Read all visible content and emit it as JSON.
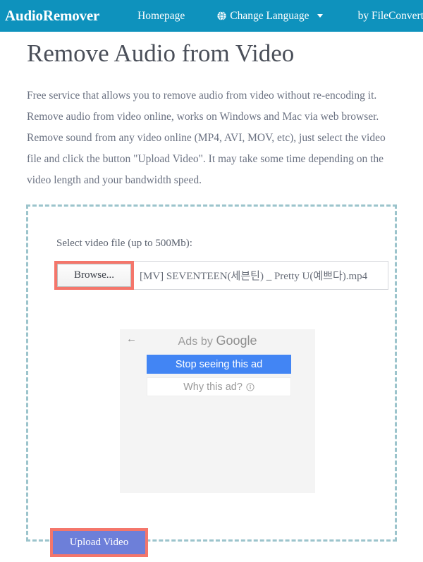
{
  "navbar": {
    "brand": "AudioRemover",
    "links": [
      {
        "label": "Homepage",
        "name": "nav-link-homepage"
      },
      {
        "label": "Change Language",
        "name": "nav-link-change-language",
        "icon": "globe-icon",
        "caret": "chevron-down-icon"
      },
      {
        "label": "by FileConverto",
        "name": "nav-link-by-fileconverto"
      }
    ],
    "background_color": "#0e92bd",
    "text_color": "#ffffff"
  },
  "main": {
    "title": "Remove Audio from Video",
    "intro": "Free service that allows you to remove audio from video without re-encoding it. Remove audio from video online, works on Windows and Mac via web browser. Remove sound from any video online (MP4, AVI, MOV, etc), just select the video file and click the button \"Upload Video\". It may take some time depending on the video length and your bandwidth speed."
  },
  "upload": {
    "select_label": "Select video file (up to 500Mb):",
    "browse_label": "Browse...",
    "file_name": "[MV] SEVENTEEN(세븐틴) _ Pretty U(예쁘다).mp4",
    "submit_label": "Upload Video",
    "dashed_border_color": "#9cc4cc",
    "highlight_color": "#f4766b",
    "submit_color": "#6d7fd9"
  },
  "ad": {
    "back_arrow": "←",
    "ads_by_prefix": "Ads by ",
    "ads_by_brand": "Google",
    "stop_seeing_label": "Stop seeing this ad",
    "why_this_ad_label": "Why this ad?",
    "primary_color": "#4285f4",
    "panel_color": "#f4f4f4"
  }
}
